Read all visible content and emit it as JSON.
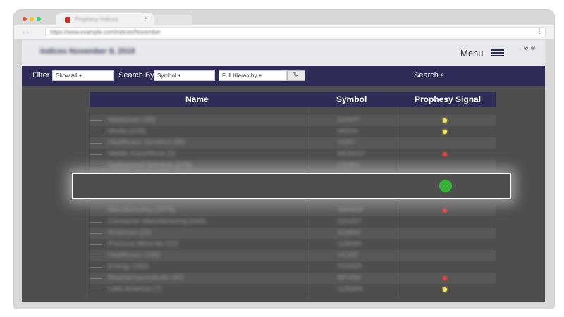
{
  "browser": {
    "tab_title": "Prophesy Indices",
    "url": "https://www.example.com/indices/November"
  },
  "header": {
    "title": "Indices November 8, 2018",
    "menu_label": "Menu"
  },
  "toolbar": {
    "filter_label": "Filter",
    "filter_value": "Show All +",
    "search_by_label": "Search By",
    "symbol_value": "Symbol +",
    "hierarchy_value": "Full Hierarchy +",
    "search_label": "Search"
  },
  "table": {
    "columns": [
      "Name",
      "Symbol",
      "Prophesy Signal"
    ],
    "rows_above": [
      {
        "name": "Midstream (58)",
        "symbol": "S200P7",
        "signal": "yellow"
      },
      {
        "name": "Media (229)",
        "symbol": "MEDIA",
        "signal": "yellow"
      },
      {
        "name": "Healthcare Services (98)",
        "symbol": "HSRV",
        "signal": ""
      },
      {
        "name": "Middle East/Africa (3)",
        "symbol": "MEA0027",
        "signal": "red"
      },
      {
        "name": "Outsourced Services (278)",
        "symbol": "OSSRV",
        "signal": ""
      }
    ],
    "rows_below": [
      {
        "name": "Manufacturing (2070)",
        "symbol": "3MANUF",
        "signal": "red"
      },
      {
        "name": "Consumer Manufacturing (444)",
        "symbol": "S2H2D7",
        "signal": ""
      },
      {
        "name": "Americas (23)",
        "symbol": "S288N0",
        "signal": ""
      },
      {
        "name": "Precious Minerals (22)",
        "symbol": "S286M4",
        "signal": ""
      },
      {
        "name": "Healthcare (198)",
        "symbol": "HC4RF",
        "signal": ""
      },
      {
        "name": "Energy (282)",
        "symbol": "POWER",
        "signal": ""
      },
      {
        "name": "Biopharmaceuticals (40)",
        "symbol": "BPHRM",
        "signal": "red"
      },
      {
        "name": "Latin America (7)",
        "symbol": "S280846",
        "signal": "yellow"
      }
    ],
    "highlight_signal": "green"
  },
  "colors": {
    "nav_bar": "#2f2d57",
    "signal_green": "#37b437",
    "signal_yellow": "#f3e45a",
    "signal_red": "#e0463f"
  }
}
